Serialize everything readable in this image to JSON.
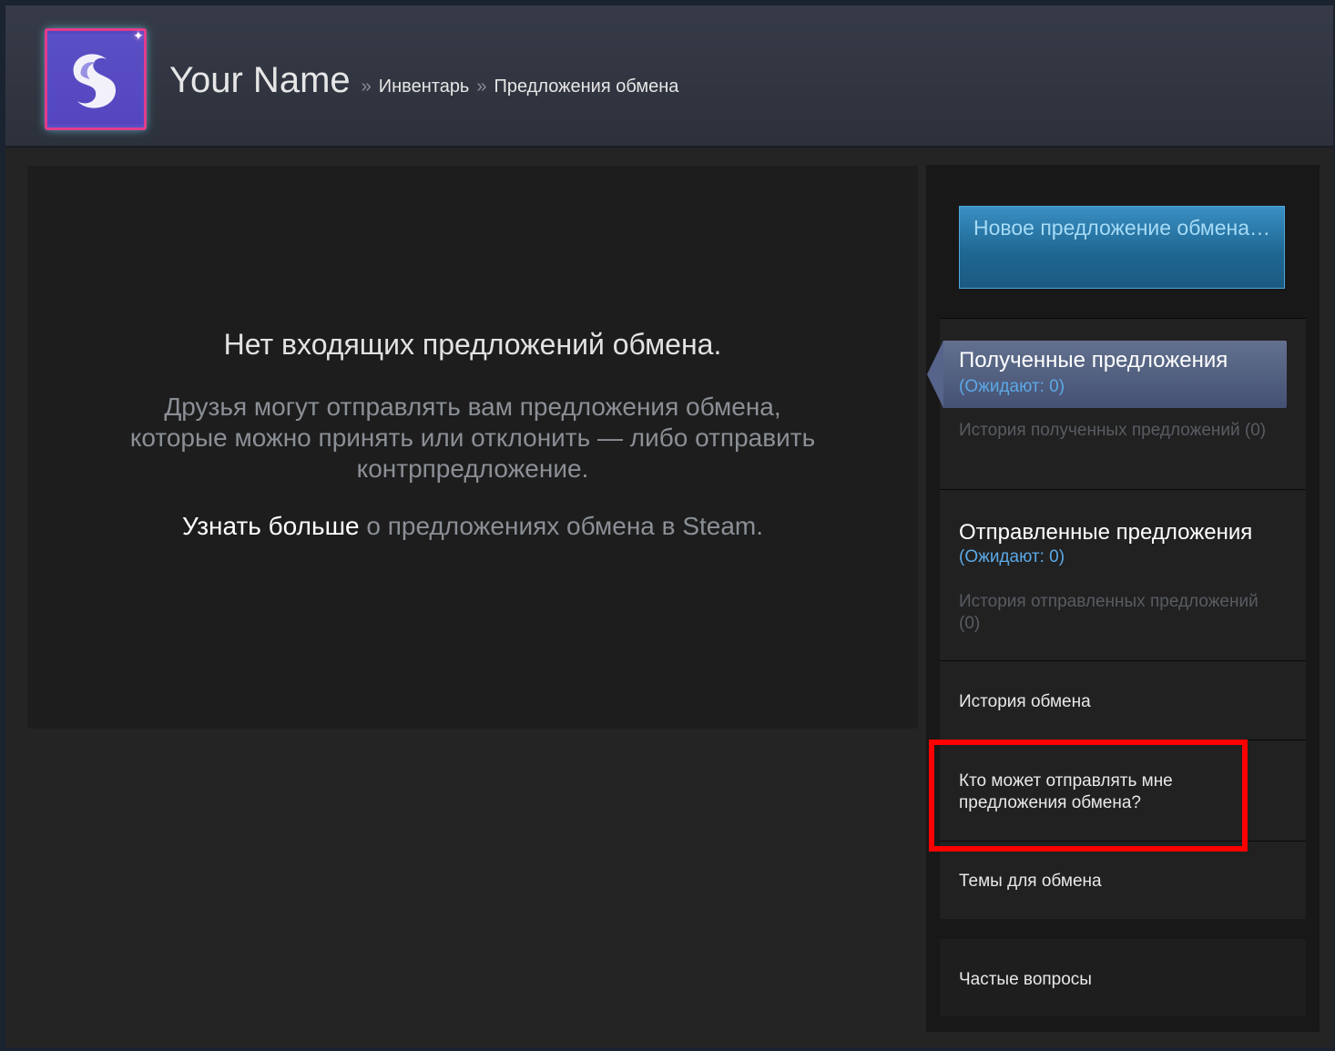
{
  "header": {
    "profile_name": "Your Name",
    "separator": "»",
    "breadcrumb_inventory": "Инвентарь",
    "breadcrumb_trade_offers": "Предложения обмена",
    "avatar_icon": "steam-swirl-logo",
    "sparkle_icon": "✦"
  },
  "main": {
    "empty_title": "Нет входящих предложений обмена.",
    "empty_desc": "Друзья могут отправлять вам предложения обмена, которые можно принять или отклонить — либо отправить контрпредложение.",
    "learn_more_link": "Узнать больше",
    "learn_more_rest": " о предложениях обмена в Steam."
  },
  "sidebar": {
    "new_offer_button": "Новое предложение обмена…",
    "received": {
      "title": "Полученные предложения",
      "pending": "(Ожидают: 0)",
      "history": "История полученных предложений (0)"
    },
    "sent": {
      "title": "Отправленные предложения",
      "pending": "(Ожидают: 0)",
      "history": "История отправленных предложений (0)"
    },
    "trade_history": "История обмена",
    "who_can_send": "Кто может отправлять мне предложения обмена?",
    "trade_topics": "Темы для обмена",
    "faq": "Частые вопросы"
  },
  "colors": {
    "accent_blue": "#5ca9e6",
    "button_blue": "#1f6893",
    "highlight_red": "#ff0000"
  }
}
